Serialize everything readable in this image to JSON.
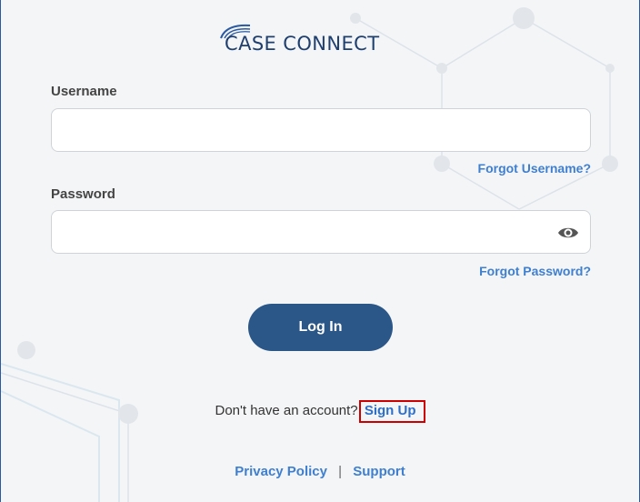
{
  "logo": {
    "text": "CASE CONNECT"
  },
  "username": {
    "label": "Username",
    "value": "",
    "placeholder": "",
    "forgot_link": "Forgot Username?"
  },
  "password": {
    "label": "Password",
    "value": "",
    "placeholder": "",
    "forgot_link": "Forgot Password?",
    "toggle_icon": "eye-icon"
  },
  "login_button": {
    "label": "Log In"
  },
  "signup": {
    "prompt": "Don't have an account?",
    "link": "Sign Up"
  },
  "footer": {
    "privacy_link": "Privacy Policy",
    "separator": "|",
    "support_link": "Support"
  },
  "colors": {
    "primary_button": "#2b5688",
    "link": "#3f7fcf",
    "highlight_border": "#cc0000",
    "background": "#f4f5f7"
  }
}
